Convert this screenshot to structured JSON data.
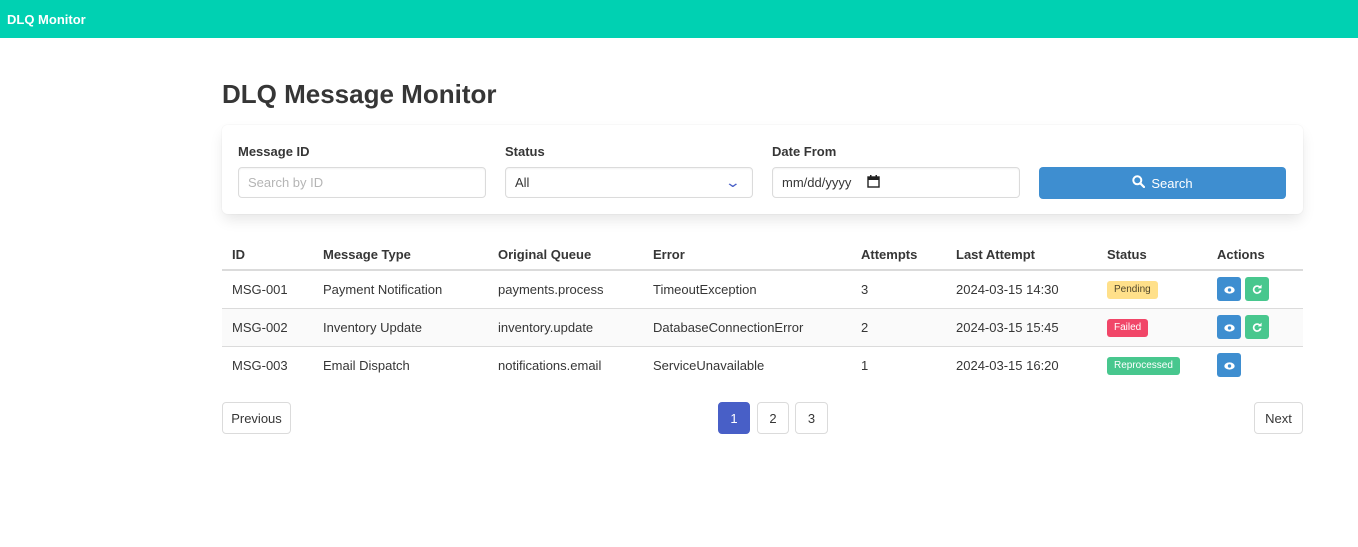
{
  "navbar": {
    "brand": "DLQ Monitor"
  },
  "page": {
    "title": "DLQ Message Monitor"
  },
  "filters": {
    "message_id": {
      "label": "Message ID",
      "placeholder": "Search by ID",
      "value": ""
    },
    "status": {
      "label": "Status",
      "value": "All"
    },
    "date_from": {
      "label": "Date From",
      "value": "mm/dd/yyyy"
    },
    "search_label": "Search"
  },
  "table": {
    "headers": [
      "ID",
      "Message Type",
      "Original Queue",
      "Error",
      "Attempts",
      "Last Attempt",
      "Status",
      "Actions"
    ],
    "rows": [
      {
        "id": "MSG-001",
        "type": "Payment Notification",
        "queue": "payments.process",
        "error": "TimeoutException",
        "attempts": "3",
        "last": "2024-03-15 14:30",
        "status": "Pending"
      },
      {
        "id": "MSG-002",
        "type": "Inventory Update",
        "queue": "inventory.update",
        "error": "DatabaseConnectionError",
        "attempts": "2",
        "last": "2024-03-15 15:45",
        "status": "Failed"
      },
      {
        "id": "MSG-003",
        "type": "Email Dispatch",
        "queue": "notifications.email",
        "error": "ServiceUnavailable",
        "attempts": "1",
        "last": "2024-03-15 16:20",
        "status": "Reprocessed"
      }
    ]
  },
  "pagination": {
    "previous": "Previous",
    "next": "Next",
    "pages": [
      "1",
      "2",
      "3"
    ],
    "current": "1"
  },
  "colors": {
    "navbar": "#00d1b2",
    "primary": "#3e8ed0",
    "link": "#485fc7",
    "success": "#48c78e",
    "warning": "#ffe08a",
    "danger": "#f14668"
  }
}
